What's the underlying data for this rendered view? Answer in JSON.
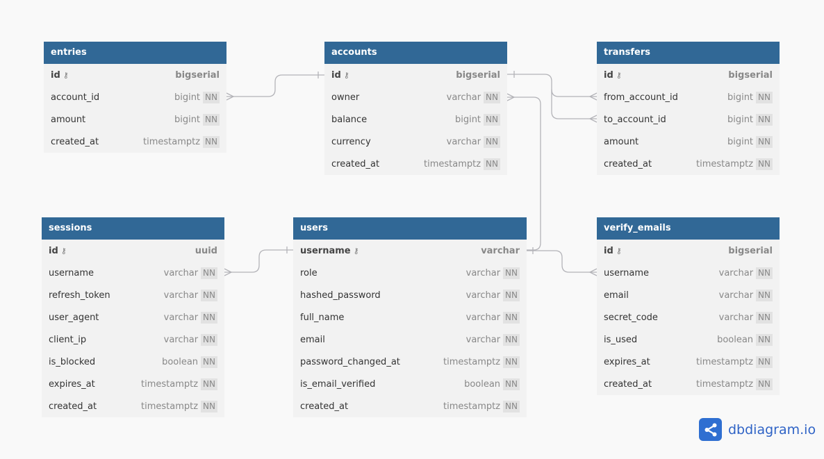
{
  "tables": {
    "entries": {
      "name": "entries",
      "columns": [
        {
          "name": "id",
          "type": "bigserial",
          "pk": true
        },
        {
          "name": "account_id",
          "type": "bigint",
          "nn": "NN"
        },
        {
          "name": "amount",
          "type": "bigint",
          "nn": "NN"
        },
        {
          "name": "created_at",
          "type": "timestamptz",
          "nn": "NN"
        }
      ]
    },
    "accounts": {
      "name": "accounts",
      "columns": [
        {
          "name": "id",
          "type": "bigserial",
          "pk": true
        },
        {
          "name": "owner",
          "type": "varchar",
          "nn": "NN"
        },
        {
          "name": "balance",
          "type": "bigint",
          "nn": "NN"
        },
        {
          "name": "currency",
          "type": "varchar",
          "nn": "NN"
        },
        {
          "name": "created_at",
          "type": "timestamptz",
          "nn": "NN"
        }
      ]
    },
    "transfers": {
      "name": "transfers",
      "columns": [
        {
          "name": "id",
          "type": "bigserial",
          "pk": true
        },
        {
          "name": "from_account_id",
          "type": "bigint",
          "nn": "NN"
        },
        {
          "name": "to_account_id",
          "type": "bigint",
          "nn": "NN"
        },
        {
          "name": "amount",
          "type": "bigint",
          "nn": "NN"
        },
        {
          "name": "created_at",
          "type": "timestamptz",
          "nn": "NN"
        }
      ]
    },
    "sessions": {
      "name": "sessions",
      "columns": [
        {
          "name": "id",
          "type": "uuid",
          "pk": true
        },
        {
          "name": "username",
          "type": "varchar",
          "nn": "NN"
        },
        {
          "name": "refresh_token",
          "type": "varchar",
          "nn": "NN"
        },
        {
          "name": "user_agent",
          "type": "varchar",
          "nn": "NN"
        },
        {
          "name": "client_ip",
          "type": "varchar",
          "nn": "NN"
        },
        {
          "name": "is_blocked",
          "type": "boolean",
          "nn": "NN"
        },
        {
          "name": "expires_at",
          "type": "timestamptz",
          "nn": "NN"
        },
        {
          "name": "created_at",
          "type": "timestamptz",
          "nn": "NN"
        }
      ]
    },
    "users": {
      "name": "users",
      "columns": [
        {
          "name": "username",
          "type": "varchar",
          "pk": true
        },
        {
          "name": "role",
          "type": "varchar",
          "nn": "NN"
        },
        {
          "name": "hashed_password",
          "type": "varchar",
          "nn": "NN"
        },
        {
          "name": "full_name",
          "type": "varchar",
          "nn": "NN"
        },
        {
          "name": "email",
          "type": "varchar",
          "nn": "NN"
        },
        {
          "name": "password_changed_at",
          "type": "timestamptz",
          "nn": "NN"
        },
        {
          "name": "is_email_verified",
          "type": "boolean",
          "nn": "NN"
        },
        {
          "name": "created_at",
          "type": "timestamptz",
          "nn": "NN"
        }
      ]
    },
    "verify_emails": {
      "name": "verify_emails",
      "columns": [
        {
          "name": "id",
          "type": "bigserial",
          "pk": true
        },
        {
          "name": "username",
          "type": "varchar",
          "nn": "NN"
        },
        {
          "name": "email",
          "type": "varchar",
          "nn": "NN"
        },
        {
          "name": "secret_code",
          "type": "varchar",
          "nn": "NN"
        },
        {
          "name": "is_used",
          "type": "boolean",
          "nn": "NN"
        },
        {
          "name": "expires_at",
          "type": "timestamptz",
          "nn": "NN"
        },
        {
          "name": "created_at",
          "type": "timestamptz",
          "nn": "NN"
        }
      ]
    }
  },
  "relationships": [
    {
      "from": "entries.account_id",
      "to": "accounts.id",
      "type": "many-to-one"
    },
    {
      "from": "transfers.from_account_id",
      "to": "accounts.id",
      "type": "many-to-one"
    },
    {
      "from": "transfers.to_account_id",
      "to": "accounts.id",
      "type": "many-to-one"
    },
    {
      "from": "accounts.owner",
      "to": "users.username",
      "type": "many-to-one"
    },
    {
      "from": "sessions.username",
      "to": "users.username",
      "type": "many-to-one"
    },
    {
      "from": "verify_emails.username",
      "to": "users.username",
      "type": "many-to-one"
    }
  ],
  "brand": {
    "text": "dbdiagram.io",
    "color": "#2f63c6"
  },
  "colors": {
    "header": "#316896",
    "body": "#f2f2f2",
    "link": "#b3b3b8"
  }
}
